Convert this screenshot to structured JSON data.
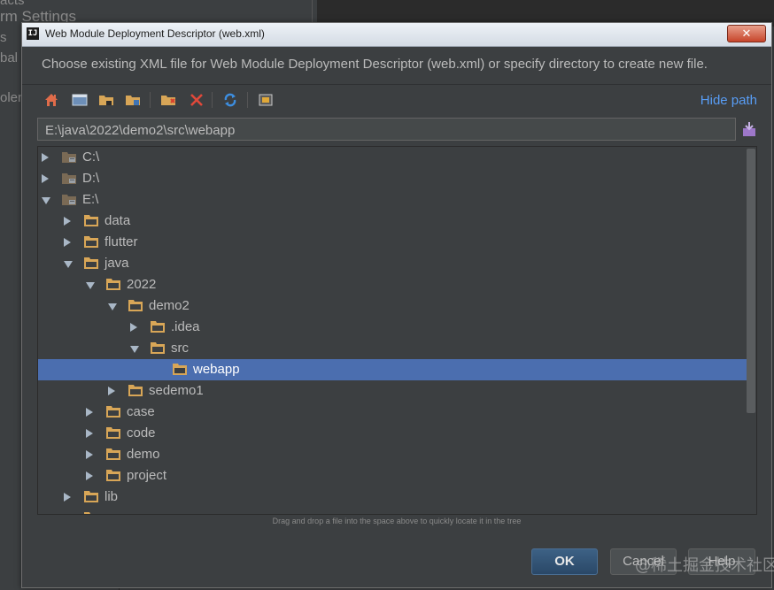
{
  "background": {
    "fragments": [
      "acts",
      "rm Settings",
      "s",
      "bal",
      "oler"
    ]
  },
  "dialog": {
    "title": "Web Module Deployment Descriptor (web.xml)",
    "title_icon": "IJ",
    "close_label": "✕",
    "description": "Choose existing XML file for Web Module Deployment Descriptor (web.xml) or specify directory to create new file.",
    "hide_path_label": "Hide path",
    "path_value": "E:\\java\\2022\\demo2\\src\\webapp",
    "hint": "Drag and drop a file into the space above to quickly locate it in the tree",
    "ok_label": "OK",
    "cancel_label": "Cancel",
    "help_label": "Help",
    "watermark": "@稀土掘金技术社区"
  },
  "toolbar": {
    "icons": [
      "home-icon",
      "desktop-icon",
      "project-folder-icon",
      "module-folder-icon",
      "new-folder-icon",
      "delete-icon",
      "refresh-icon",
      "show-hidden-icon"
    ]
  },
  "tree": [
    {
      "label": "C:\\",
      "type": "drive",
      "expanded": false,
      "selected": false,
      "depth": 0
    },
    {
      "label": "D:\\",
      "type": "drive",
      "expanded": false,
      "selected": false,
      "depth": 0
    },
    {
      "label": "E:\\",
      "type": "drive",
      "expanded": true,
      "selected": false,
      "depth": 0
    },
    {
      "label": "data",
      "type": "folder",
      "expanded": false,
      "selected": false,
      "depth": 1
    },
    {
      "label": "flutter",
      "type": "folder",
      "expanded": false,
      "selected": false,
      "depth": 1
    },
    {
      "label": "java",
      "type": "folder",
      "expanded": true,
      "selected": false,
      "depth": 1
    },
    {
      "label": "2022",
      "type": "folder",
      "expanded": true,
      "selected": false,
      "depth": 2
    },
    {
      "label": "demo2",
      "type": "folder",
      "expanded": true,
      "selected": false,
      "depth": 3
    },
    {
      "label": ".idea",
      "type": "folder",
      "expanded": false,
      "selected": false,
      "depth": 4
    },
    {
      "label": "src",
      "type": "folder",
      "expanded": true,
      "selected": false,
      "depth": 4
    },
    {
      "label": "webapp",
      "type": "folder",
      "expanded": null,
      "selected": true,
      "depth": 5
    },
    {
      "label": "sedemo1",
      "type": "folder",
      "expanded": false,
      "selected": false,
      "depth": 3
    },
    {
      "label": "case",
      "type": "folder",
      "expanded": false,
      "selected": false,
      "depth": 2
    },
    {
      "label": "code",
      "type": "folder",
      "expanded": false,
      "selected": false,
      "depth": 2
    },
    {
      "label": "demo",
      "type": "folder",
      "expanded": false,
      "selected": false,
      "depth": 2
    },
    {
      "label": "project",
      "type": "folder",
      "expanded": false,
      "selected": false,
      "depth": 2
    },
    {
      "label": "lib",
      "type": "folder",
      "expanded": false,
      "selected": false,
      "depth": 1
    },
    {
      "label": "",
      "type": "folder",
      "expanded": false,
      "selected": false,
      "depth": 1
    }
  ],
  "colors": {
    "accent": "#589df6",
    "selection": "#4b6eaf",
    "folder": "#d8a657",
    "drive": "#8c8c8c"
  }
}
